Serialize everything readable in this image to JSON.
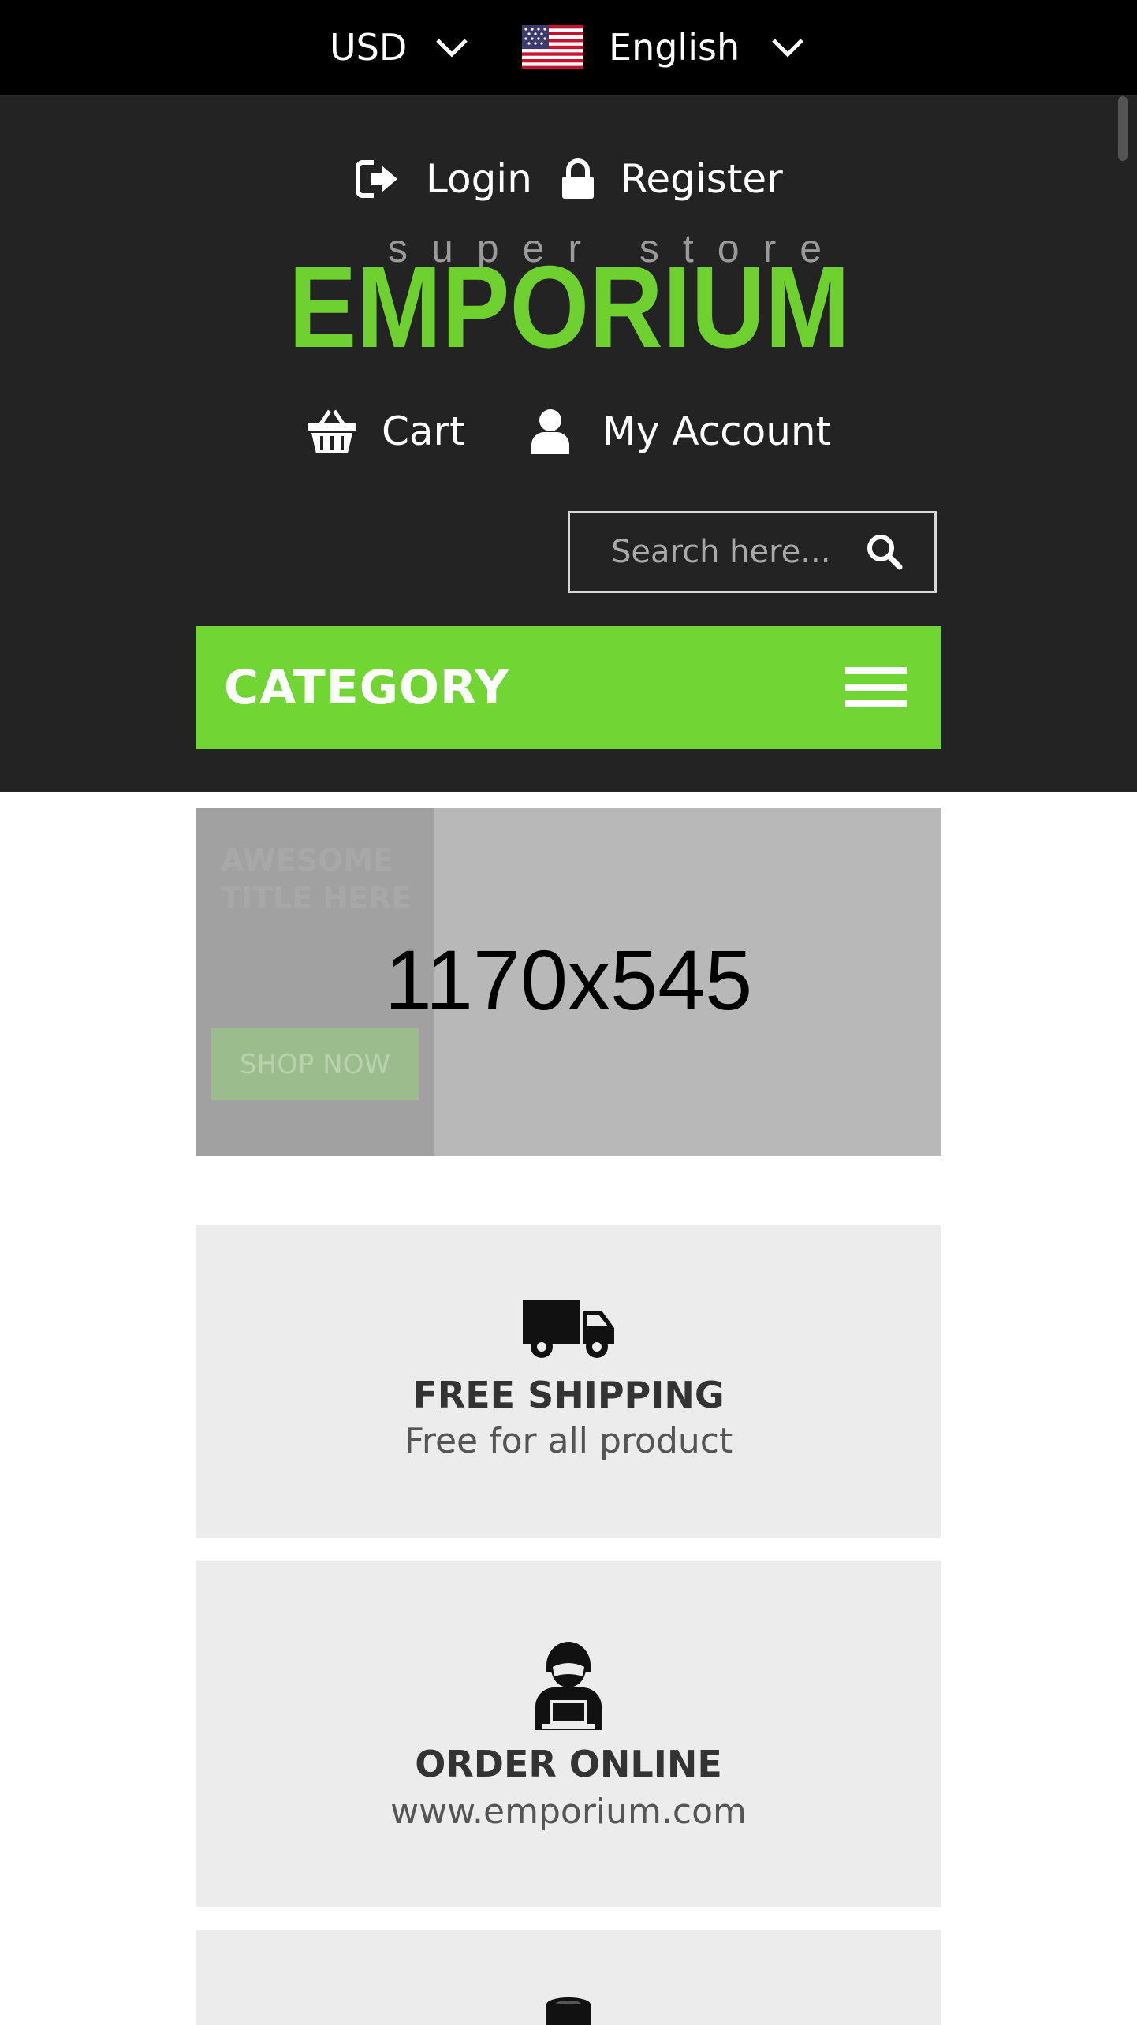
{
  "topbar": {
    "currency": "USD",
    "language": "English"
  },
  "header": {
    "login": "Login",
    "register": "Register",
    "logo_top": "super store",
    "logo_main": "EMPORIUM",
    "cart": "Cart",
    "account": "My Account",
    "search_placeholder": "Search here...",
    "category": "CATEGORY"
  },
  "banner": {
    "title": "AWESOME TITLE HERE",
    "dimensions": "1170x545",
    "button": "SHOP NOW"
  },
  "features": [
    {
      "icon": "truck-icon",
      "title": "FREE SHIPPING",
      "subtitle": "Free for all product"
    },
    {
      "icon": "operator-icon",
      "title": "ORDER ONLINE",
      "subtitle": "www.emporium.com"
    },
    {
      "icon": "coins-icon"
    }
  ],
  "colors": {
    "topbar_bg": "#000000",
    "header_bg": "#232323",
    "accent": "#71d533",
    "feature_bg": "#ececec",
    "banner_bg": "#b8b8b8"
  }
}
